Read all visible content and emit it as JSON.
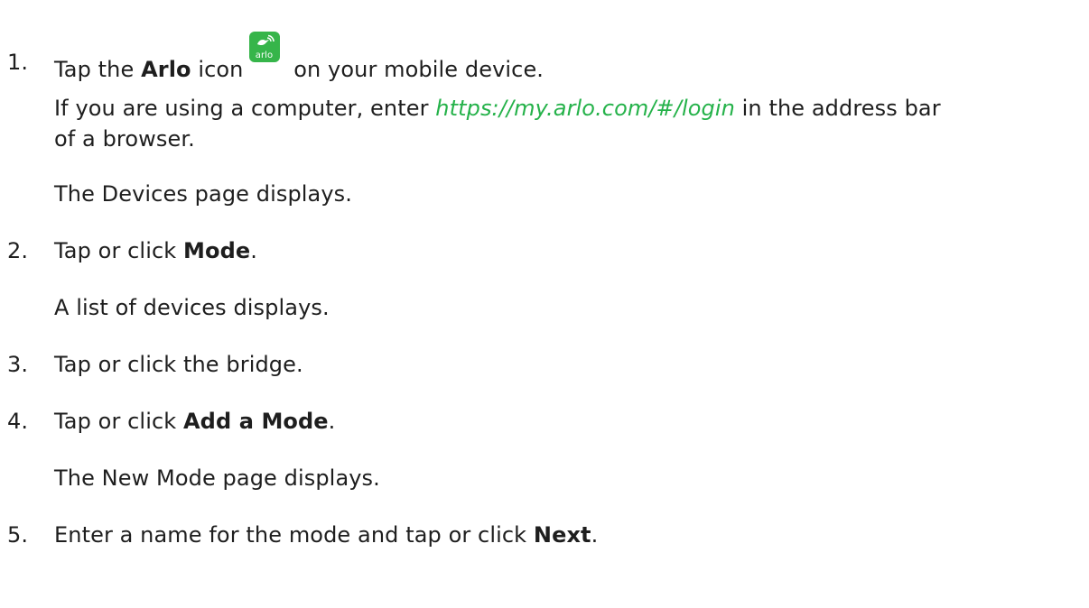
{
  "steps": [
    {
      "number": "1.",
      "pre": "Tap the ",
      "bold": "Arlo",
      "post_bold": " icon",
      "post_icon": " on your mobile device.",
      "icon": {
        "name": "arlo-app-icon",
        "label": "arlo",
        "color": "#36b54a"
      },
      "paragraphs": [
        {
          "pre": "If you are using a computer, enter ",
          "link": "https://my.arlo.com/#/login",
          "post_line1": " in the address bar",
          "line2": "of a browser."
        },
        {
          "text": "The Devices page displays."
        }
      ]
    },
    {
      "number": "2.",
      "pre": "Tap or click ",
      "bold": "Mode",
      "post": ".",
      "paragraphs": [
        {
          "text": "A list of devices displays."
        }
      ]
    },
    {
      "number": "3.",
      "text": "Tap or click the bridge."
    },
    {
      "number": "4.",
      "pre": "Tap or click ",
      "bold": "Add a Mode",
      "post": ".",
      "paragraphs": [
        {
          "text": "The New Mode page displays."
        }
      ]
    },
    {
      "number": "5.",
      "pre": "Enter a name for the mode and tap or click ",
      "bold": "Next",
      "post": "."
    }
  ],
  "colors": {
    "text": "#1e1e1e",
    "link": "#25b24a",
    "accent": "#36b54a"
  }
}
